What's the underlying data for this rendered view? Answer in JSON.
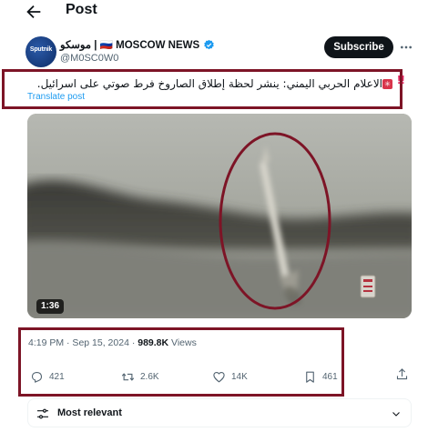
{
  "header": {
    "title": "Post"
  },
  "author": {
    "avatar_text": "Sputnik",
    "display_name": "موسكو | 🇷🇺 MOSCOW NEWS",
    "handle": "@M0SC0W0",
    "subscribe_label": "Subscribe"
  },
  "post": {
    "text": "الاعلام الحربي اليمني: ينشر لحظة إطلاق الصاروخ فرط صوتي على اسرائيل.",
    "badge_symbol": "✳",
    "exclamation": "!!",
    "translate_label": "Translate post",
    "video_duration": "1:36"
  },
  "meta": {
    "timestamp": "4:19 PM · Sep 15, 2024 · ",
    "views_count": "989.8K",
    "views_label": " Views"
  },
  "actions": {
    "replies": "421",
    "reposts": "2.6K",
    "likes": "14K",
    "bookmarks": "461"
  },
  "sort": {
    "label": "Most relevant"
  },
  "colors": {
    "annotation_border": "#7d1426",
    "link": "#1d9bf0",
    "verified": "#1d9bf0",
    "subscribe_bg": "#0f1419"
  }
}
